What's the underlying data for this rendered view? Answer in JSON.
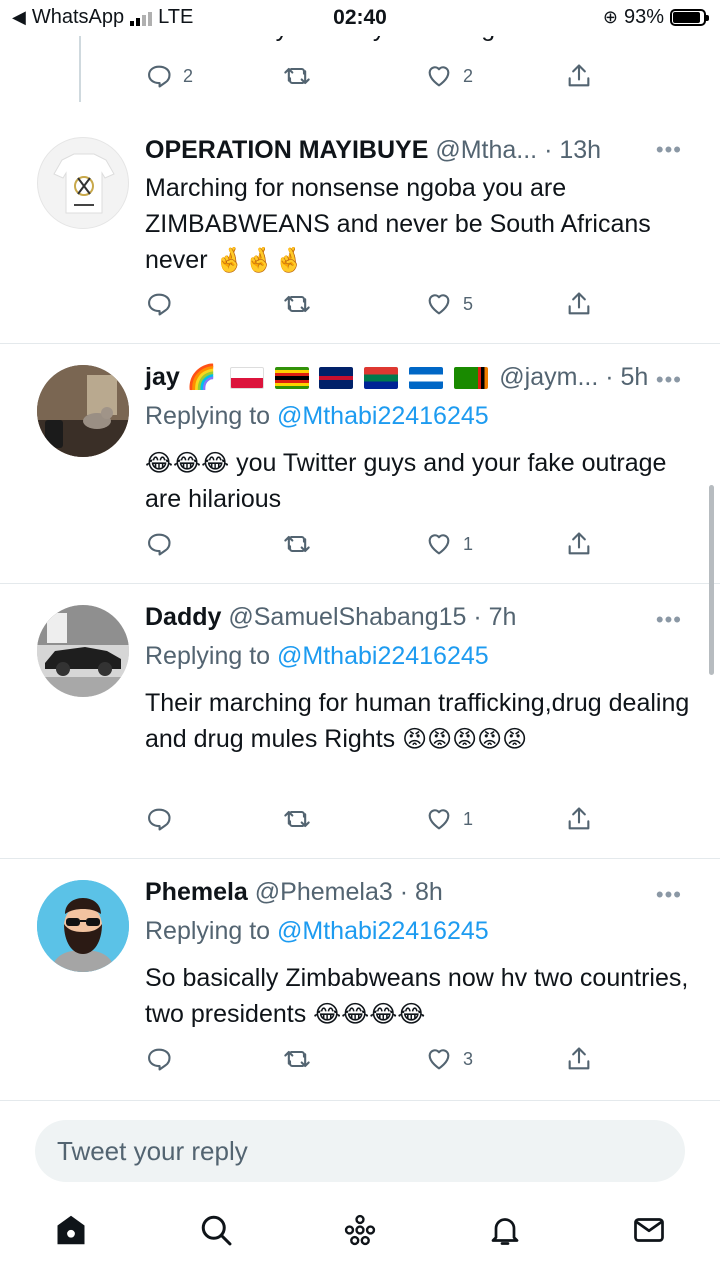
{
  "status_bar": {
    "back_app": "WhatsApp",
    "network": "LTE",
    "time": "02:40",
    "battery": "93%",
    "battery_level": 0.93
  },
  "previous_tweet": {
    "cut_text": "What exactly are they marching for?",
    "replies": "2",
    "likes": "2"
  },
  "tweets": [
    {
      "name": "OPERATION MAYIBUYE",
      "handle": "@Mtha...",
      "time": "· 13h",
      "replying_prefix": "",
      "replying_to": "",
      "text": "Marching for nonsense ngoba you are ZIMBABWEANS and never be South Africans never",
      "emojis": "🤞🤞🤞",
      "replies": "",
      "likes": "5"
    },
    {
      "name": "jay",
      "name_emoji": "🌈",
      "handle": "@jaym...",
      "time": "· 5h",
      "replying_prefix": "Replying to",
      "replying_to": "@Mthabi22416245",
      "leading_emojis": "😂😂😂",
      "text": " you Twitter guys and your fake outrage are hilarious",
      "replies": "",
      "likes": "1"
    },
    {
      "name": "Daddy",
      "handle": "@SamuelShabang15",
      "time": "· 7h",
      "replying_prefix": "Replying to",
      "replying_to": "@Mthabi22416245",
      "text": "Their marching for human trafficking,drug dealing and drug mules Rights ",
      "emojis": "😡😡😡😡😡",
      "replies": "",
      "likes": "1"
    },
    {
      "name": "Phemela",
      "handle": "@Phemela3",
      "time": "· 8h",
      "replying_prefix": "Replying to",
      "replying_to": "@Mthabi22416245",
      "text": "So basically Zimbabweans now hv two countries, two presidents ",
      "emojis": "😂😂😂😂",
      "replies": "",
      "likes": "3"
    }
  ],
  "reply_box": {
    "placeholder": "Tweet your reply"
  },
  "colors": {
    "link": "#1d9bf0",
    "secondary_text": "#536471",
    "divider": "#e4e9ec"
  }
}
